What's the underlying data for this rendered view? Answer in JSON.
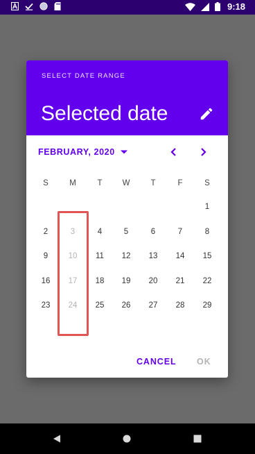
{
  "status_bar": {
    "time": "9:18",
    "icons": [
      "a-notification-icon",
      "check-notification-icon",
      "circle-notification-icon",
      "sd-card-icon",
      "wifi-icon",
      "cellular-icon",
      "battery-icon"
    ]
  },
  "dialog": {
    "header_label": "SELECT DATE RANGE",
    "title": "Selected date",
    "edit_icon": "pencil-icon",
    "month_label": "FEBRUARY, 2020",
    "dropdown_icon": "triangle-down-icon",
    "prev_icon": "chevron-left-icon",
    "next_icon": "chevron-right-icon",
    "weekdays": [
      "S",
      "M",
      "T",
      "W",
      "T",
      "F",
      "S"
    ],
    "weeks": [
      [
        "",
        "",
        "",
        "",
        "",
        "",
        "1"
      ],
      [
        "2",
        "3",
        "4",
        "5",
        "6",
        "7",
        "8"
      ],
      [
        "9",
        "10",
        "11",
        "12",
        "13",
        "14",
        "15"
      ],
      [
        "16",
        "17",
        "18",
        "19",
        "20",
        "21",
        "22"
      ],
      [
        "23",
        "24",
        "25",
        "26",
        "27",
        "28",
        "29"
      ]
    ],
    "disabled_days": [
      "3",
      "10",
      "17",
      "24"
    ],
    "cancel_label": "CANCEL",
    "ok_label": "OK"
  },
  "colors": {
    "status_bar": "#2d0070",
    "header": "#6200ee",
    "accent": "#6200ee",
    "highlight_border": "#e05555",
    "disabled_text": "#b4b4b4"
  },
  "nav_bar": {
    "icons": [
      "back-icon",
      "home-icon",
      "recents-icon"
    ]
  }
}
